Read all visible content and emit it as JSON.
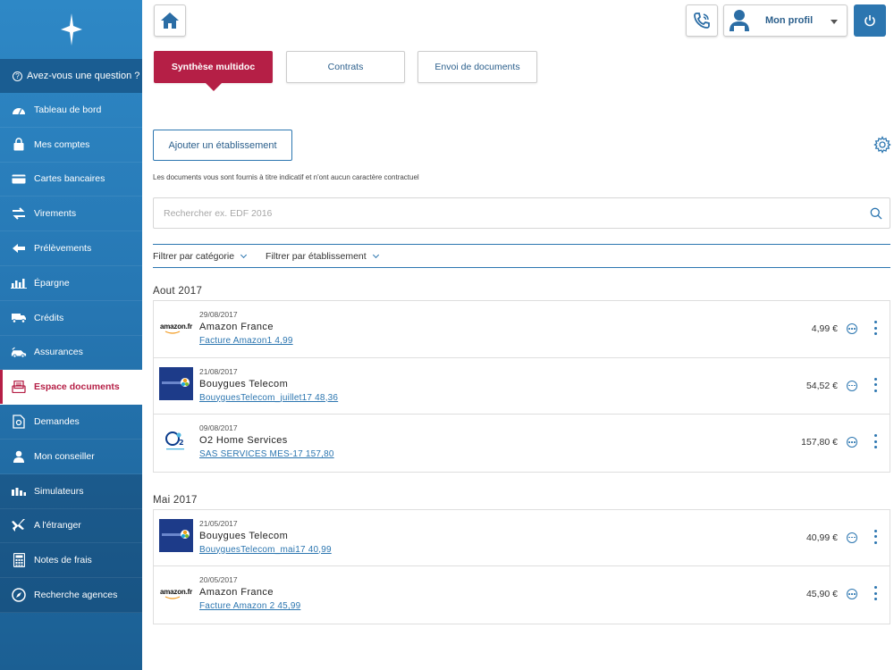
{
  "sidebar": {
    "help_label": "Avez-vous une question ?",
    "items": [
      {
        "label": "Tableau de bord",
        "icon": "dashboard-icon"
      },
      {
        "label": "Mes comptes",
        "icon": "lock-icon"
      },
      {
        "label": "Cartes bancaires",
        "icon": "card-icon"
      },
      {
        "label": "Virements",
        "icon": "transfer-icon"
      },
      {
        "label": "Prélèvements",
        "icon": "debit-icon"
      },
      {
        "label": "Épargne",
        "icon": "savings-icon"
      },
      {
        "label": "Crédits",
        "icon": "truck-icon"
      },
      {
        "label": "Assurances",
        "icon": "car-icon"
      },
      {
        "label": "Espace documents",
        "icon": "documents-icon"
      },
      {
        "label": "Demandes",
        "icon": "request-icon"
      },
      {
        "label": "Mon conseiller",
        "icon": "advisor-icon"
      },
      {
        "label": "Simulateurs",
        "icon": "chart-icon"
      },
      {
        "label": "A l'étranger",
        "icon": "plane-icon"
      },
      {
        "label": "Notes de frais",
        "icon": "calculator-icon"
      },
      {
        "label": "Recherche agences",
        "icon": "compass-icon"
      }
    ]
  },
  "header": {
    "profile_label": "Mon profil"
  },
  "tabs": [
    {
      "label": "Synthèse multidoc"
    },
    {
      "label": "Contrats"
    },
    {
      "label": "Envoi de documents"
    }
  ],
  "actions": {
    "add_label": "Ajouter un établissement",
    "disclaimer": "Les documents vous sont fournis à titre indicatif et n'ont aucun caractère contractuel"
  },
  "search": {
    "placeholder": "Rechercher ex. EDF 2016"
  },
  "filters": {
    "category": "Filtrer par catégorie",
    "establishment": "Filtrer par établissement"
  },
  "groups": [
    {
      "title": "Aout 2017",
      "docs": [
        {
          "logo": "amazon",
          "logo_text": "amazon.fr",
          "date": "29/08/2017",
          "name": "Amazon France",
          "file": "Facture Amazon1 4,99",
          "amount": "4,99 €"
        },
        {
          "logo": "bouygues",
          "date": "21/08/2017",
          "name": "Bouygues Telecom",
          "file": "BouyguesTelecom_juillet17 48,36",
          "amount": "54,52 €"
        },
        {
          "logo": "o2",
          "date": "09/08/2017",
          "name": "O2 Home Services",
          "file": "SAS SERVICES MES-17 157,80",
          "amount": "157,80 €"
        }
      ]
    },
    {
      "title": "Mai 2017",
      "docs": [
        {
          "logo": "bouygues",
          "date": "21/05/2017",
          "name": "Bouygues Telecom",
          "file": "BouyguesTelecom_mai17 40,99",
          "amount": "40,99 €"
        },
        {
          "logo": "amazon",
          "logo_text": "amazon.fr",
          "date": "20/05/2017",
          "name": "Amazon France",
          "file": "Facture Amazon 2 45,99",
          "amount": "45,90 €"
        }
      ]
    }
  ],
  "colors": {
    "brand_blue": "#2c76b0",
    "accent_red": "#b51f46"
  }
}
